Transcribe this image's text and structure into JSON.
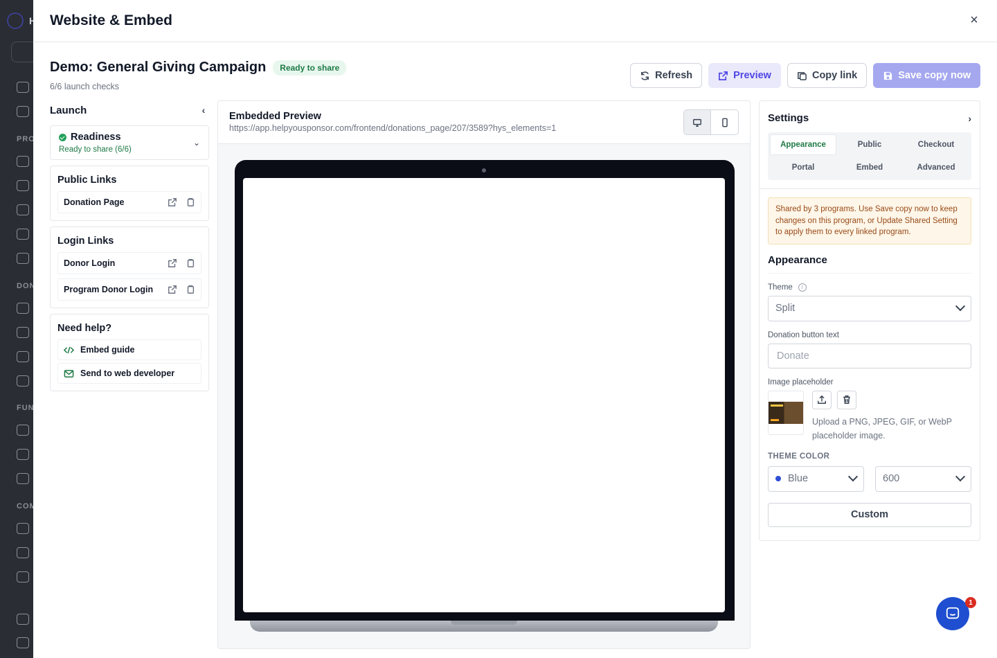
{
  "background_app": {
    "logo_letter": "H",
    "section_labels": [
      "PRO",
      "DON",
      "FUN",
      "COM"
    ]
  },
  "modal": {
    "title": "Website & Embed",
    "close_label": "×"
  },
  "campaign": {
    "title": "Demo: General Giving Campaign",
    "status_badge": "Ready to share",
    "checks": "6/6 launch checks"
  },
  "actions": {
    "refresh": "Refresh",
    "preview": "Preview",
    "copy_link": "Copy link",
    "save_copy": "Save copy now"
  },
  "launch": {
    "title": "Launch",
    "readiness": {
      "title": "Readiness",
      "subtitle": "Ready to share (6/6)"
    },
    "public_links": {
      "title": "Public Links",
      "items": [
        {
          "label": "Donation Page"
        }
      ]
    },
    "login_links": {
      "title": "Login Links",
      "items": [
        {
          "label": "Donor Login"
        },
        {
          "label": "Program Donor Login"
        }
      ]
    },
    "help": {
      "title": "Need help?",
      "items": [
        {
          "label": "Embed guide",
          "icon": "code-icon"
        },
        {
          "label": "Send to web developer",
          "icon": "mail-icon"
        }
      ]
    }
  },
  "preview": {
    "title": "Embedded Preview",
    "url": "https://app.helpyousponsor.com/frontend/donations_page/207/3589?hys_elements=1",
    "devices": [
      "desktop-icon",
      "mobile-icon"
    ],
    "active_device": "desktop"
  },
  "settings": {
    "title": "Settings",
    "tabs": [
      "Appearance",
      "Public",
      "Checkout",
      "Portal",
      "Embed",
      "Advanced"
    ],
    "active_tab": "Appearance",
    "notice": "Shared by 3 programs. Use Save copy now to keep changes on this program, or Update Shared Setting to apply them to every linked program.",
    "section_title": "Appearance",
    "theme": {
      "label": "Theme",
      "value": "Split"
    },
    "donation_button": {
      "label": "Donation button text",
      "placeholder": "Donate"
    },
    "image": {
      "label": "Image placeholder",
      "hint": "Upload a PNG, JPEG, GIF, or WebP placeholder image."
    },
    "theme_color": {
      "label": "THEME COLOR",
      "color": "Blue",
      "shade": "600",
      "swatch": "#2f4fd6",
      "custom": "Custom"
    }
  },
  "chat": {
    "unread_count": "1"
  },
  "colors": {
    "accent": "#4f46e5",
    "success": "#1e7a46",
    "warning_text": "#9a4a16"
  }
}
